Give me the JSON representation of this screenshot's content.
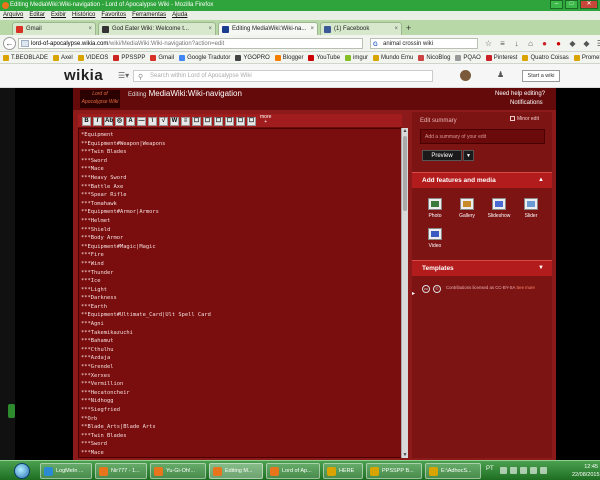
{
  "window": {
    "title": "Editing MediaWiki:Wiki-navigation - Lord of Apocalypse Wiki - Mozilla Firefox",
    "minimize": "–",
    "maximize": "□",
    "close": "✕"
  },
  "menu": [
    "Arquivo",
    "Editar",
    "Exibir",
    "Histórico",
    "Favoritos",
    "Ferramentas",
    "Ajuda"
  ],
  "tabs": [
    {
      "label": "Gmail",
      "color": "#d93025",
      "active": false
    },
    {
      "label": "God Eater Wiki: Welcome t...",
      "color": "#333333",
      "active": false
    },
    {
      "label": "Editing MediaWiki:Wiki-na...",
      "color": "#1a3d8f",
      "active": true
    },
    {
      "label": "(1) Facebook",
      "color": "#3b5998",
      "active": false
    }
  ],
  "nav": {
    "url_domain": "lord-of-apocalypse.wikia.com",
    "url_path": "/wiki/MediaWiki:Wiki-navigation?action=edit",
    "search_value": "animal crossin wiki",
    "search_engine_glyph": "G"
  },
  "bookmarks": [
    {
      "label": "T.BEOBLADE",
      "color": "#d9a400"
    },
    {
      "label": "Axel",
      "color": "#d9a400"
    },
    {
      "label": "VIDEOS",
      "color": "#d9a400"
    },
    {
      "label": "PPSSPP",
      "color": "#cc2222"
    },
    {
      "label": "Gmail",
      "color": "#d93025"
    },
    {
      "label": "Google Tradutor",
      "color": "#4285f4"
    },
    {
      "label": "YGOPRO",
      "color": "#444444"
    },
    {
      "label": "Blogger",
      "color": "#f57d00"
    },
    {
      "label": "YouTube",
      "color": "#cc0000"
    },
    {
      "label": "imgur",
      "color": "#85bf25"
    },
    {
      "label": "Mundo Emu",
      "color": "#d9a400"
    },
    {
      "label": "NicoBlog",
      "color": "#cc4444"
    },
    {
      "label": "PQAO",
      "color": "#999999"
    },
    {
      "label": "Pinterest",
      "color": "#cb2027"
    },
    {
      "label": "Quatro Coisas",
      "color": "#d9a400"
    },
    {
      "label": "Prometheus Online",
      "color": "#d9a400"
    }
  ],
  "wikia": {
    "logo": "wikia",
    "search_placeholder": "Search within Lord of Apocalypse Wiki",
    "start_wiki": "Start a wiki"
  },
  "editor": {
    "logo_text": "Lord of Apocalypse Wiki",
    "editing_label": "Editing",
    "page_name": "MediaWiki:Wiki-navigation",
    "help_link": "Need help editing?",
    "notifications_link": "Notifications",
    "toolbar_more": "more",
    "toolbar_buttons": [
      "B",
      "I",
      "Ab",
      "◎",
      "A",
      "—",
      "\\",
      "√",
      "W",
      "≡",
      "☐",
      "☐",
      "☐",
      "☐",
      "☐",
      "☐"
    ],
    "code_lines": [
      "*Equipment",
      "**Equipment#Weapon|Weapons",
      "***Twin Blades",
      "***Sword",
      "***Mace",
      "***Heavy Sword",
      "***Battle Axe",
      "***Spear Rifle",
      "***Tomahawk",
      "**Equipment#Armor|Armors",
      "***Helmet",
      "***Shield",
      "***Body Armor",
      "**Equipment#Magic|Magic",
      "***Fire",
      "***Wind",
      "***Thunder",
      "***Ice",
      "***Light",
      "***Darkness",
      "***Earth",
      "**Equipment#Ultimate_Card|Ult Spell Card",
      "***Agni",
      "***Takemikazuchi",
      "***Bahamut",
      "***Cthulhu",
      "***Azdaja",
      "***Grendel",
      "***Xerxes",
      "***Vermillion",
      "***Hecatoncheir",
      "***Nidhogg",
      "***Siegfried",
      "**Orb",
      "**Blade_Arts|Blade Arts",
      "***Twin Blades",
      "***Sword",
      "***Mace"
    ]
  },
  "right": {
    "minor_edit": "Minor edit",
    "edit_summary_label": "Edit summary",
    "edit_summary_placeholder": "Add a summary of your edit",
    "preview_button": "Preview",
    "features_title": "Add features and media",
    "media_buttons": [
      {
        "label": "Photo",
        "color": "#3a7a3a"
      },
      {
        "label": "Gallery",
        "color": "#c98a2a"
      },
      {
        "label": "Slideshow",
        "color": "#4a6ad2"
      },
      {
        "label": "Slider",
        "color": "#6a9bd2"
      },
      {
        "label": "Video",
        "color": "#3a5ac2"
      }
    ],
    "templates_title": "Templates",
    "license_text": "Contributions licensed as CC-BY-SA",
    "license_link": "See more"
  },
  "taskbar": {
    "items": [
      {
        "label": "LogMeIn ...",
        "color": "#2a8ad2",
        "active": false
      },
      {
        "label": "Nir777 - 1...",
        "color": "#e8741c",
        "active": false
      },
      {
        "label": "Yu-Gi-Oh!...",
        "color": "#e8741c",
        "active": false
      },
      {
        "label": "Editing M...",
        "color": "#e8741c",
        "active": true
      },
      {
        "label": "Lord of Ap...",
        "color": "#e8741c",
        "active": false
      },
      {
        "label": "HERE",
        "color": "#d9a400",
        "active": false
      },
      {
        "label": "PPSSPP B...",
        "color": "#d9a400",
        "active": false
      },
      {
        "label": "E:\\AdhocS...",
        "color": "#d9a400",
        "active": false
      }
    ],
    "lang": "PT",
    "time": "12:45",
    "date": "22/08/2015"
  }
}
